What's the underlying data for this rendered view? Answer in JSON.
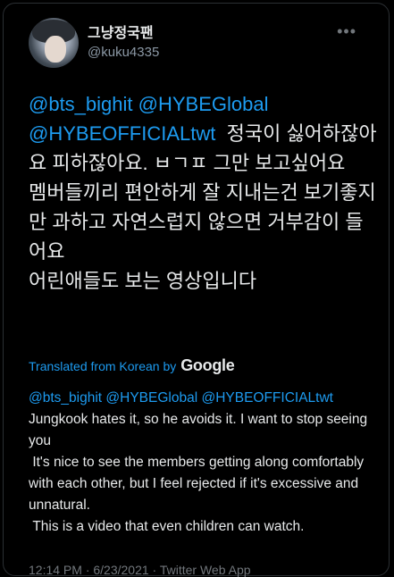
{
  "user": {
    "display_name": "그냥정국팬",
    "handle": "@kuku4335"
  },
  "menu": {
    "more_icon": "more-horizontal-icon"
  },
  "tweet": {
    "mentions": [
      "@bts_bighit",
      "@HYBEGlobal",
      "@HYBEOFFICIALtwt"
    ],
    "text_line1_rest": "정국이 싫어하잖아요 피하잖아요. ㅂㄱㅍ 그만 보고싶어요",
    "paragraph2": "멤버들끼리 편안하게 잘 지내는건 보기좋지만 과하고 자연스럽지 않으면 거부감이 들어요",
    "paragraph3": "어린애들도 보는 영상입니다"
  },
  "translation_label": {
    "prefix": "Translated from Korean by",
    "provider": "Google"
  },
  "translation": {
    "mentions": [
      "@bts_bighit",
      "@HYBEGlobal",
      "@HYBEOFFICIALtwt"
    ],
    "line1": "Jungkook hates it, so he avoids it. I want to stop seeing you",
    "line2": " It's nice to see the members getting along comfortably with each other, but I feel rejected if it's excessive and unnatural.",
    "line3": " This is a video that even children can watch."
  },
  "footer": {
    "text": "12:14 PM · 6/23/2021 · Twitter Web App"
  },
  "colors": {
    "link": "#1d9bf0",
    "text": "#e7e9ea",
    "muted": "#8b98a5",
    "background": "#000000"
  }
}
